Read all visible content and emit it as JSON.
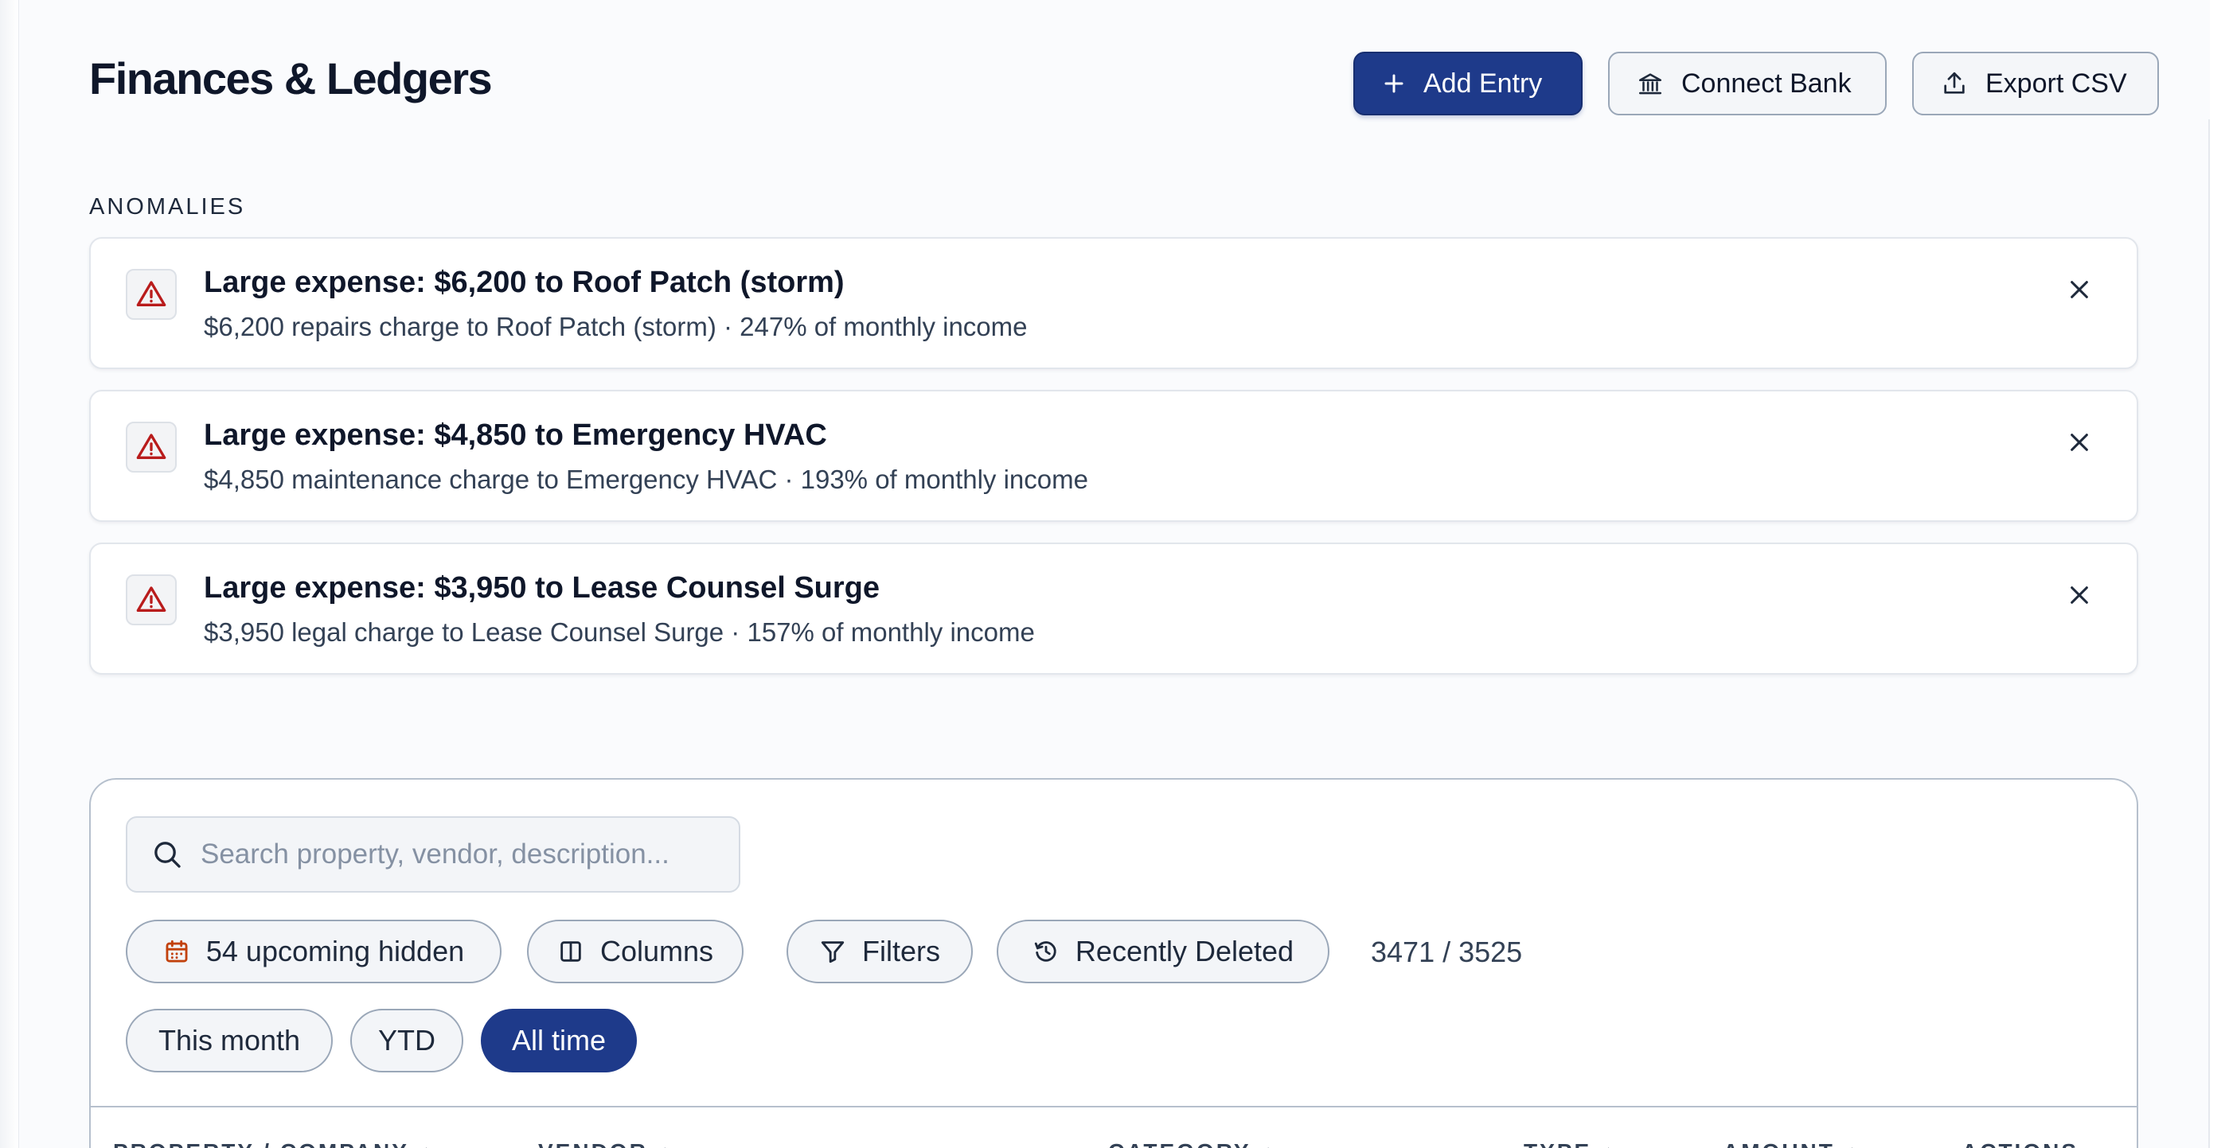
{
  "header": {
    "title": "Finances & Ledgers",
    "add_entry_label": "Add Entry",
    "connect_bank_label": "Connect Bank",
    "export_csv_label": "Export CSV"
  },
  "anomalies": {
    "label": "ANOMALIES",
    "items": [
      {
        "title": "Large expense: $6,200 to Roof Patch (storm)",
        "description": "$6,200 repairs charge to Roof Patch (storm) · 247% of monthly income"
      },
      {
        "title": "Large expense: $4,850 to Emergency HVAC",
        "description": "$4,850 maintenance charge to Emergency HVAC · 193% of monthly income"
      },
      {
        "title": "Large expense: $3,950 to Lease Counsel Surge",
        "description": "$3,950 legal charge to Lease Counsel Surge · 157% of monthly income"
      }
    ]
  },
  "toolbar": {
    "search_placeholder": "Search property, vendor, description...",
    "search_value": "",
    "upcoming_label": "54 upcoming hidden",
    "columns_label": "Columns",
    "filters_label": "Filters",
    "recently_deleted_label": "Recently Deleted",
    "count": "3471 / 3525"
  },
  "range": {
    "options": [
      "This month",
      "YTD",
      "All time"
    ],
    "selected": "All time"
  },
  "table": {
    "columns": [
      "PROPERTY / COMPANY",
      "VENDOR",
      "CATEGORY",
      "TYPE",
      "AMOUNT",
      "ACTIONS"
    ],
    "sort_glyph": "↕"
  },
  "colors": {
    "accent": "#1e3a8a",
    "warning": "#b91c1c",
    "calendar": "#c2410c"
  },
  "icons": {
    "add": "plus-icon",
    "bank": "bank-icon",
    "export": "upload-icon",
    "warning": "warning-triangle-icon",
    "dismiss": "close-icon",
    "search": "search-icon",
    "calendar": "calendar-icon",
    "columns": "columns-icon",
    "filters": "filter-icon",
    "recently_deleted": "history-icon"
  }
}
